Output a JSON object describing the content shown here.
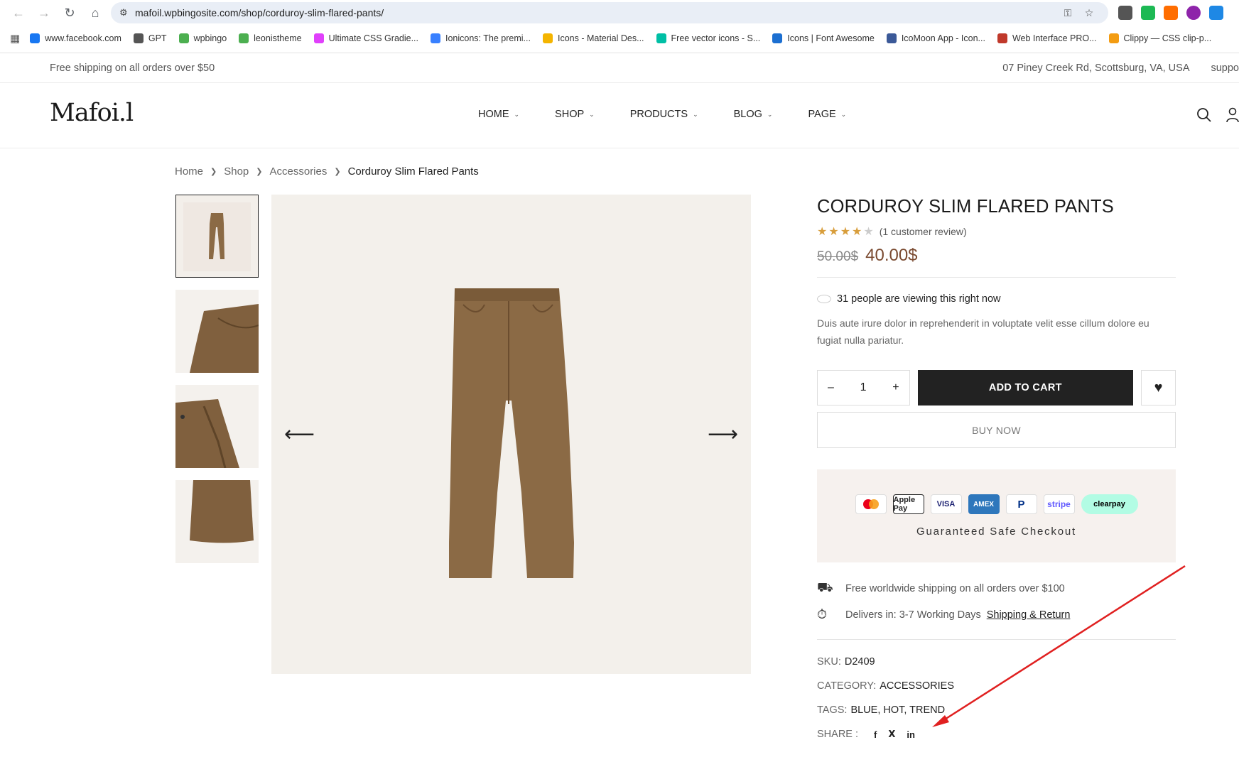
{
  "browser": {
    "url": "mafoil.wpbingosite.com/shop/corduroy-slim-flared-pants/",
    "bookmarks": [
      {
        "label": "www.facebook.com",
        "color": "#1877f2"
      },
      {
        "label": "GPT",
        "color": "#555555"
      },
      {
        "label": "wpbingo",
        "color": "#4caf50"
      },
      {
        "label": "leonistheme",
        "color": "#4caf50"
      },
      {
        "label": "Ultimate CSS Gradie...",
        "color": "#e040fb"
      },
      {
        "label": "Ionicons: The premi...",
        "color": "#3880ff"
      },
      {
        "label": "Icons - Material Des...",
        "color": "#f4b400"
      },
      {
        "label": "Free vector icons - S...",
        "color": "#00bfa5"
      },
      {
        "label": "Icons | Font Awesome",
        "color": "#1c6fd1"
      },
      {
        "label": "IcoMoon App - Icon...",
        "color": "#3b5998"
      },
      {
        "label": "Web Interface PRO...",
        "color": "#c0392b"
      },
      {
        "label": "Clippy — CSS clip-p...",
        "color": "#f39c12"
      }
    ]
  },
  "topbar": {
    "shipping": "Free shipping on all orders over $50",
    "address": "07 Piney Creek Rd, Scottsburg, VA, USA",
    "support": "suppo"
  },
  "header": {
    "logo": "Mafoi.l",
    "menu": [
      "HOME",
      "SHOP",
      "PRODUCTS",
      "BLOG",
      "PAGE"
    ]
  },
  "breadcrumb": [
    "Home",
    "Shop",
    "Accessories",
    "Corduroy Slim Flared Pants"
  ],
  "product": {
    "title": "CORDUROY SLIM FLARED PANTS",
    "rating": 4,
    "rating_max": 5,
    "reviews": "(1 customer review)",
    "old_price": "50.00$",
    "price": "40.00$",
    "viewing": "31 people are viewing this right now",
    "description": "Duis aute irure dolor in reprehenderit in voluptate velit esse cillum dolore eu fugiat nulla pariatur.",
    "qty": "1",
    "qty_minus": "–",
    "qty_plus": "+",
    "add_to_cart": "ADD TO CART",
    "buy_now": "BUY NOW",
    "safe_checkout": "Guaranteed Safe Checkout",
    "payment_methods": [
      "Mastercard",
      "Apple Pay",
      "VISA",
      "AMEX",
      "PayPal",
      "stripe",
      "clearpay"
    ],
    "shipping_line": "Free worldwide shipping on all orders over $100",
    "delivers_line": "Delivers in: 3-7 Working Days",
    "shipping_link": "Shipping & Return",
    "sku_label": "SKU:",
    "sku": "D2409",
    "category_label": "CATEGORY:",
    "category": "ACCESSORIES",
    "tags_label": "TAGS:",
    "tags": "BLUE, HOT, TREND",
    "share_label": "SHARE :",
    "share_icons": [
      "facebook-icon",
      "twitter-icon",
      "linkedin-icon"
    ]
  },
  "colors": {
    "price": "#7a4a30",
    "star": "#d89e3c",
    "pants": "#8b6a45",
    "annotation": "#e02020"
  }
}
